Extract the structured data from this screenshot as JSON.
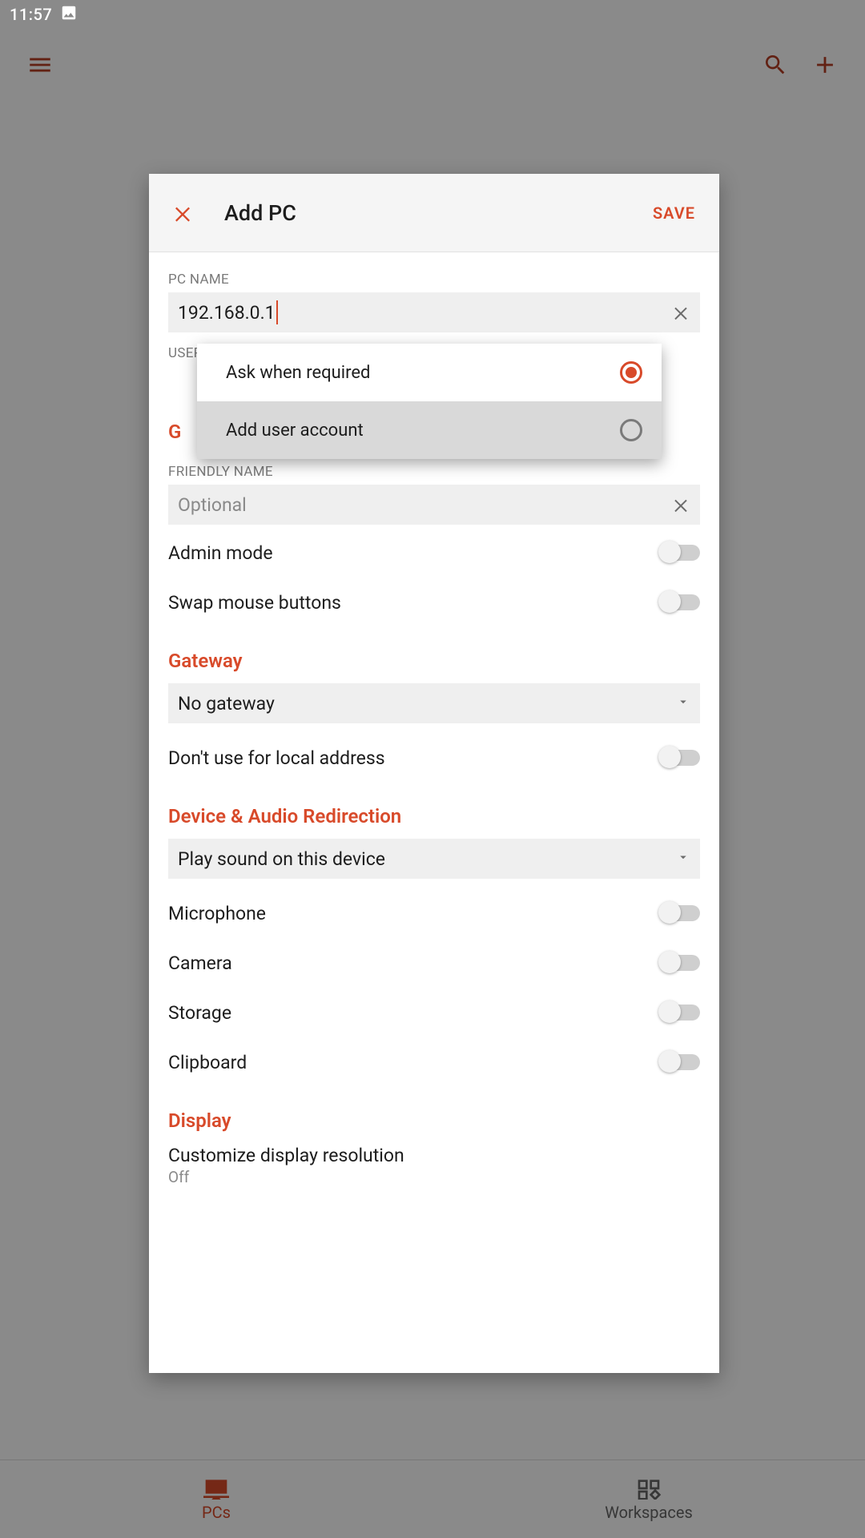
{
  "status": {
    "time": "11:57"
  },
  "nav": {
    "pcs_label": "PCs",
    "workspaces_label": "Workspaces"
  },
  "dialog": {
    "title": "Add PC",
    "save_label": "SAVE",
    "pc_name": {
      "label": "PC NAME",
      "value": "192.168.0.1"
    },
    "user_account": {
      "label": "USER ACCOUNT",
      "options": {
        "ask": "Ask when required",
        "add": "Add user account"
      }
    },
    "general_peek": "G",
    "friendly_name": {
      "label": "FRIENDLY NAME",
      "placeholder": "Optional"
    },
    "toggles": {
      "admin_mode": "Admin mode",
      "swap_mouse": "Swap mouse buttons",
      "no_local": "Don't use for local address",
      "microphone": "Microphone",
      "camera": "Camera",
      "storage": "Storage",
      "clipboard": "Clipboard"
    },
    "gateway": {
      "header": "Gateway",
      "value": "No gateway"
    },
    "audio": {
      "header": "Device & Audio Redirection",
      "value": "Play sound on this device"
    },
    "display": {
      "header": "Display",
      "custom_res_label": "Customize display resolution",
      "custom_res_value": "Off"
    }
  }
}
